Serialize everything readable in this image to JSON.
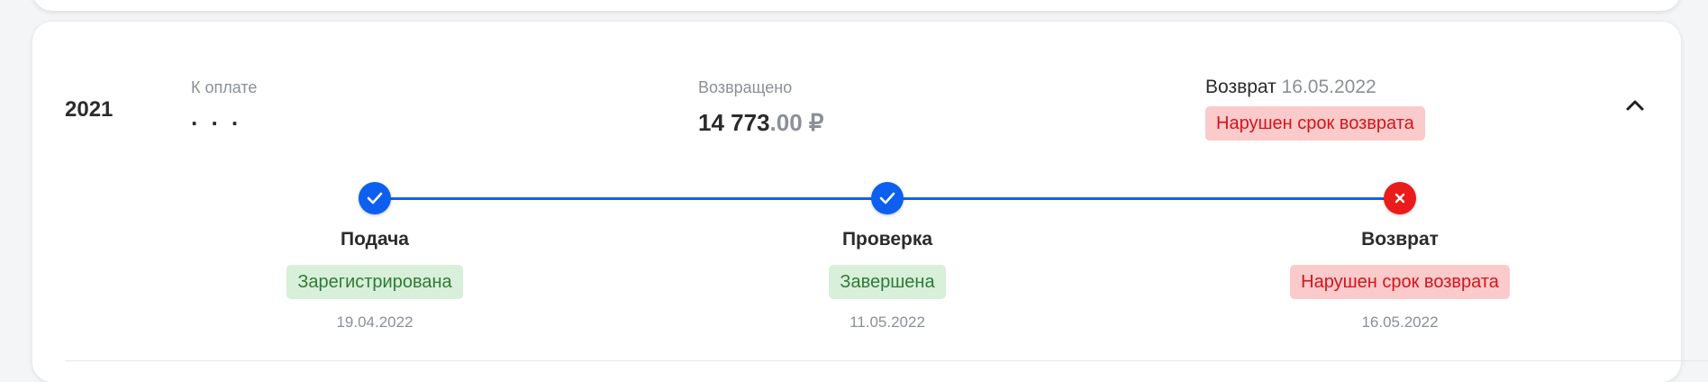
{
  "record": {
    "year": "2021",
    "to_pay_label": "К оплате",
    "to_pay_value": ". . .",
    "returned_label": "Возвращено",
    "returned_main": "14 773",
    "returned_decimal": ".00",
    "returned_currency": "₽",
    "refund_label": "Возврат",
    "refund_date": "16.05.2022",
    "refund_status": "Нарушен срок возврата"
  },
  "steps": [
    {
      "title": "Подача",
      "status": "Зарегистрирована",
      "date": "19.04.2022",
      "state": "done",
      "badge_color": "green"
    },
    {
      "title": "Проверка",
      "status": "Завершена",
      "date": "11.05.2022",
      "state": "done",
      "badge_color": "green"
    },
    {
      "title": "Возврат",
      "status": "Нарушен срок возврата",
      "date": "16.05.2022",
      "state": "failed",
      "badge_color": "red"
    }
  ],
  "colors": {
    "accent_blue": "#0d5ff0",
    "error_red": "#ea1b1b",
    "badge_red_bg": "#fbcaca",
    "badge_green_bg": "#d8efd9"
  },
  "icons": {
    "collapse": "chevron-up-icon",
    "step_done": "check-icon",
    "step_failed": "close-icon"
  }
}
